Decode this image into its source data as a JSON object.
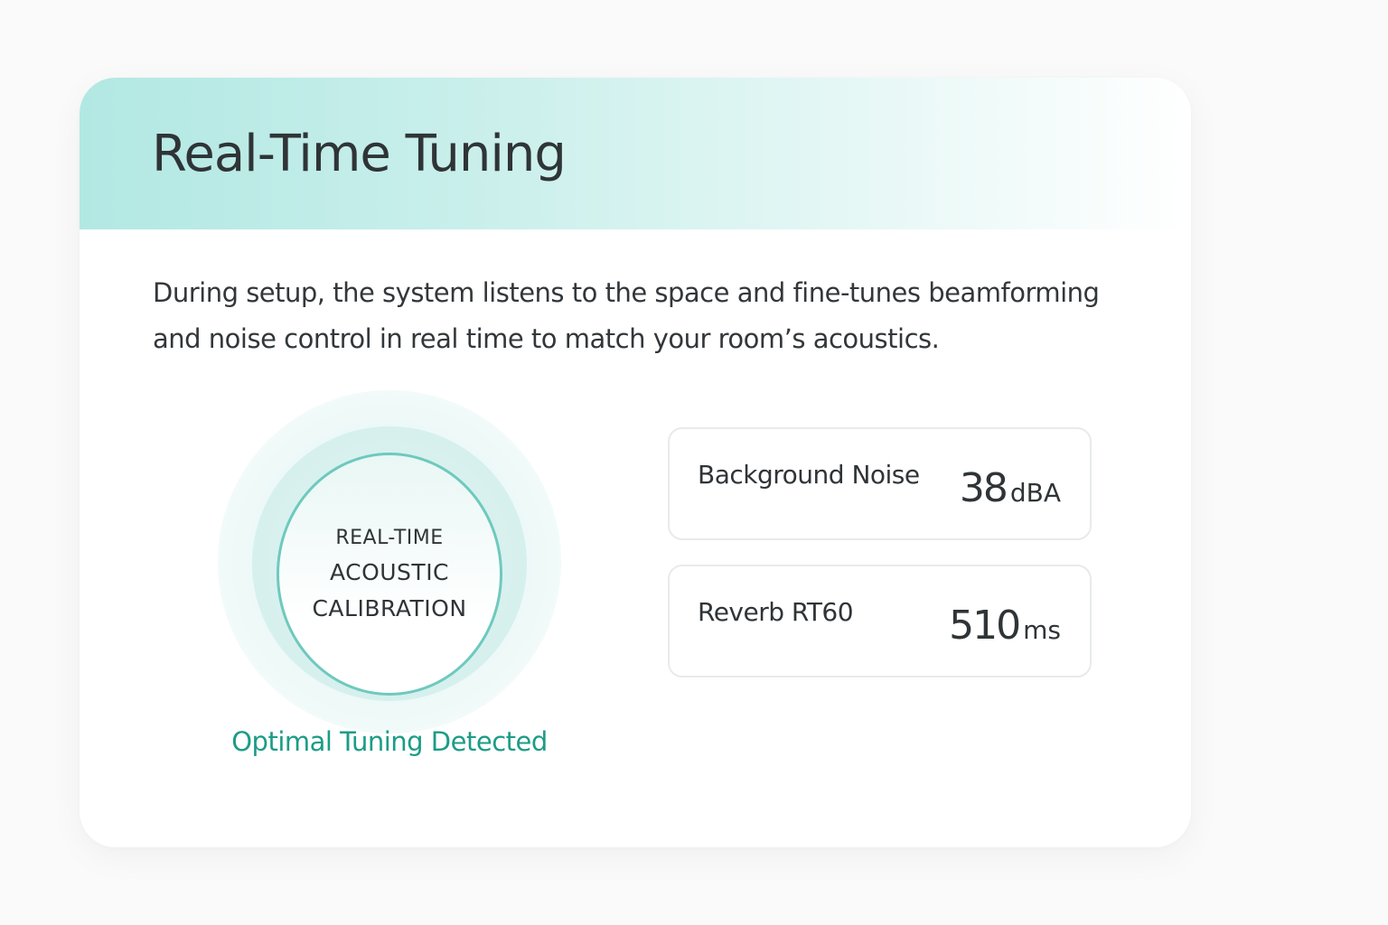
{
  "panel": {
    "title": "Real-Time Tuning",
    "description": "During setup, the system listens to the space and fine-tunes beamforming and noise control in real time to match your room’s acoustics."
  },
  "calibration": {
    "line1": "REAL-TIME",
    "line2": "ACOUSTIC",
    "line3": "CALIBRATION",
    "status": "Optimal Tuning Detected"
  },
  "metrics": [
    {
      "label": "Background Noise",
      "value": "38",
      "unit": "dBA"
    },
    {
      "label": "Reverb RT60",
      "value": "510",
      "unit": "ms"
    }
  ],
  "colors": {
    "header_gradient_start": "#b2e8e3",
    "accent": "#6ec9be",
    "status_text": "#1c9c86",
    "text": "#2f3437",
    "card_border": "#e8eaeb"
  }
}
